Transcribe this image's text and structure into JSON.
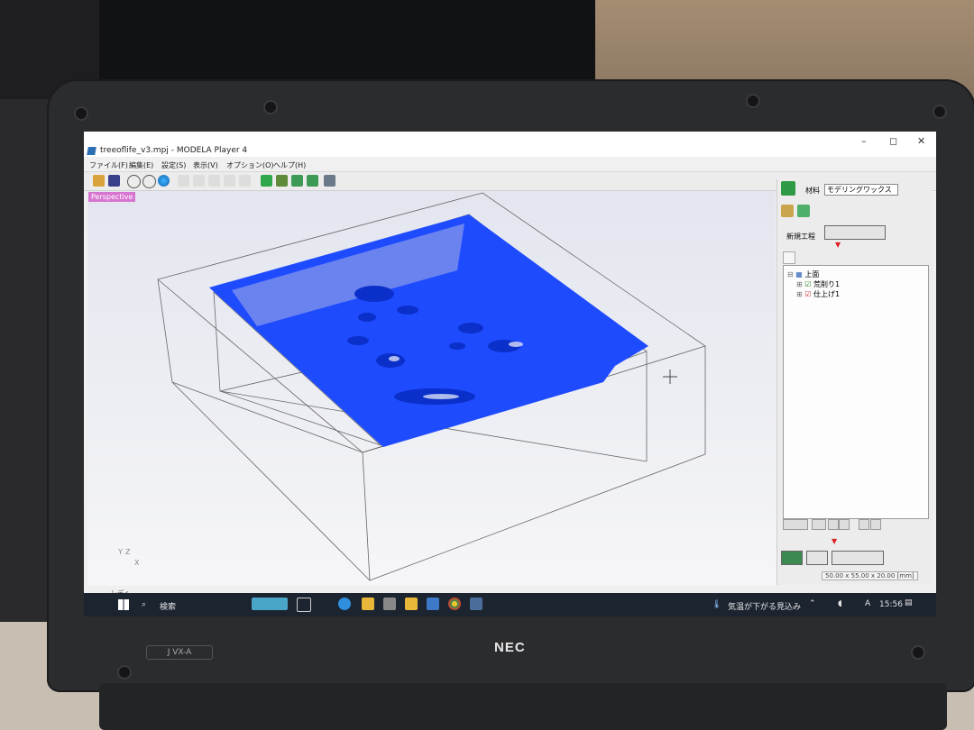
{
  "window": {
    "title": "treeoflife_v3.mpj - MODELA Player 4",
    "controls": [
      "–",
      "◻",
      "✕"
    ]
  },
  "menu": [
    "ファイル(F)",
    "編集(E)",
    "設定(S)",
    "表示(V)",
    "オプション(O)",
    "ヘルプ(H)"
  ],
  "viewport": {
    "label": "Perspective",
    "axes": [
      "Y",
      "Z",
      "X"
    ]
  },
  "panel": {
    "material_label": "材料",
    "material_value": "モデリングワックス",
    "new_process_label": "新規工程",
    "tree": {
      "root": "上面",
      "children": [
        "荒削り1",
        "仕上げ1"
      ]
    }
  },
  "status": {
    "left": "レディ",
    "size": "50.00 x 55.00 x 20.00 [mm]"
  },
  "taskbar": {
    "search": "検索",
    "weather": "気温が下がる見込み",
    "ime": "A",
    "time": "15:56"
  },
  "laptop": {
    "brand": "NEC",
    "model": "J VX-A"
  },
  "colors": {
    "workpiece": "#1f4bff",
    "taskbar": "#1c2430",
    "perspective_badge": "#d776d1"
  }
}
